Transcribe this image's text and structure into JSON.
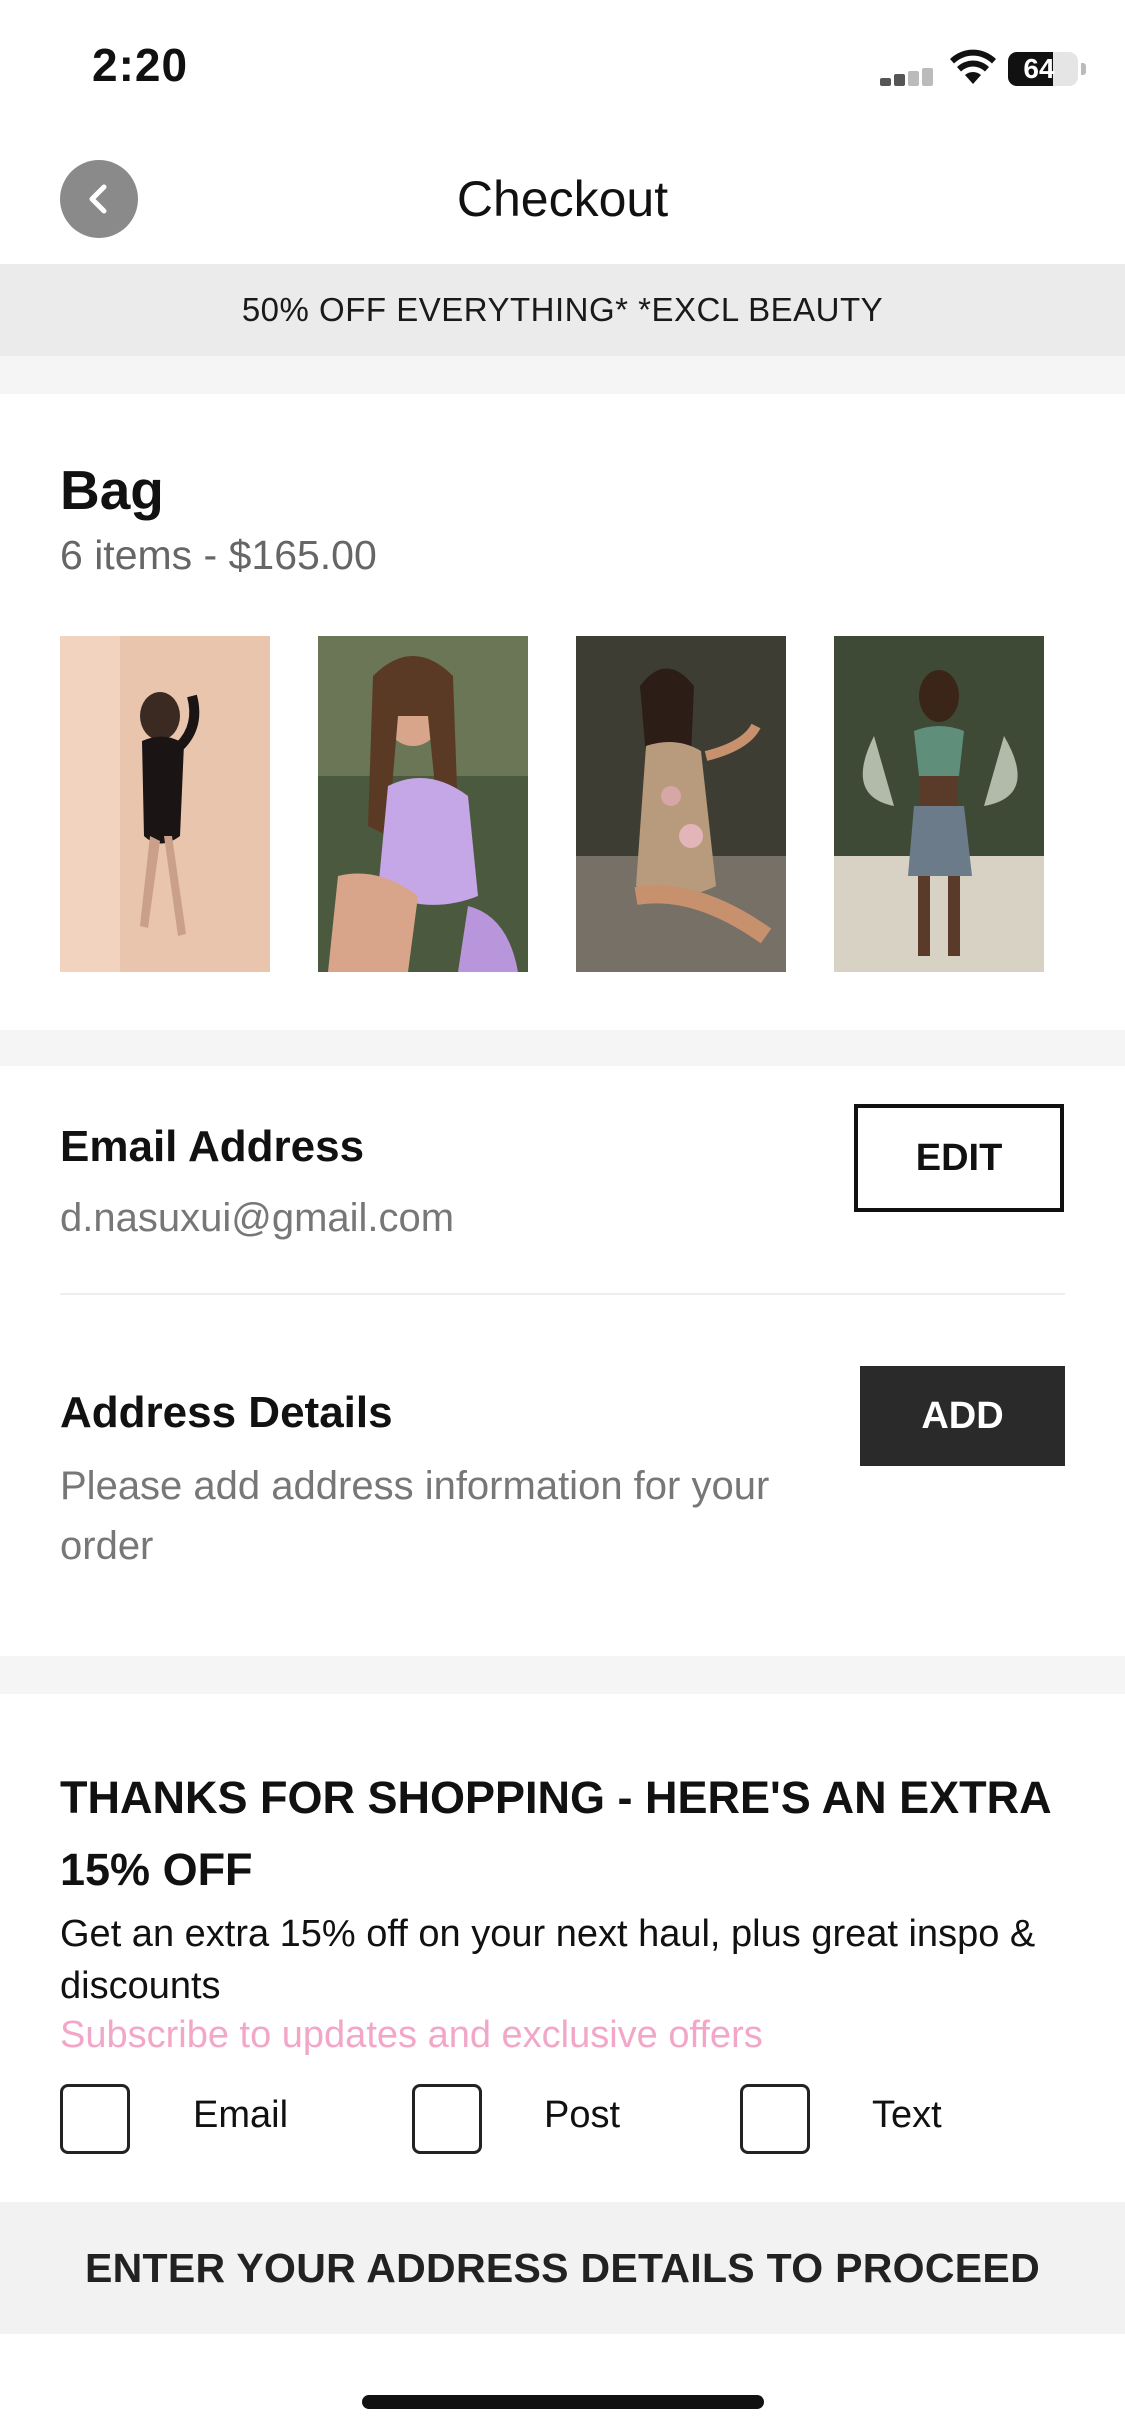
{
  "status_bar": {
    "time": "2:20",
    "battery": "64",
    "battery_level": 0.64
  },
  "header": {
    "title": "Checkout",
    "back_icon": "chevron-left-icon"
  },
  "promo_banner": {
    "text": "50% OFF EVERYTHING* *EXCL BEAUTY"
  },
  "bag": {
    "title": "Bag",
    "summary": "6 items  - $165.00",
    "thumbnails": [
      {
        "name": "black-mini-dress"
      },
      {
        "name": "lilac-cutout-dress"
      },
      {
        "name": "floral-print-outfit"
      },
      {
        "name": "green-top-denim-skirt"
      }
    ]
  },
  "email": {
    "heading": "Email Address",
    "value": "d.nasuxui@gmail.com",
    "edit_label": "EDIT"
  },
  "address": {
    "heading": "Address Details",
    "line1": "Please add address information for your",
    "line2": "order",
    "add_label": "ADD"
  },
  "marketing": {
    "heading_line1": "THANKS FOR SHOPPING - HERE'S AN EXTRA",
    "heading_line2": "15% OFF",
    "body": "Get an extra 15% off on your next haul, plus great inspo & discounts",
    "subscribe_text": "Subscribe to updates and exclusive offers",
    "options": [
      {
        "label": "Email",
        "checked": false
      },
      {
        "label": "Post",
        "checked": false
      },
      {
        "label": "Text",
        "checked": false
      }
    ]
  },
  "footer": {
    "cta": "ENTER YOUR ADDRESS DETAILS TO PROCEED"
  },
  "colors": {
    "accent_pink": "#f2a7c8",
    "dark_button": "#2a2a2a",
    "banner_bg": "#ebebeb"
  }
}
